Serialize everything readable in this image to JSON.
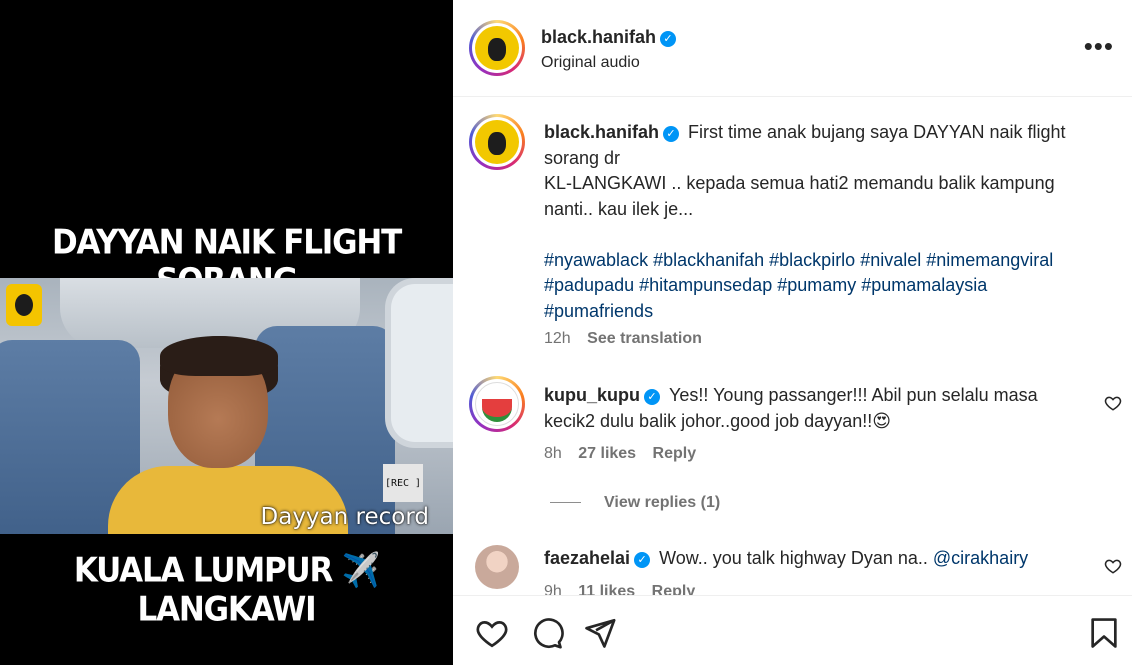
{
  "media": {
    "caption_top": "DAYYAN NAIK FLIGHT SORANG",
    "caption_bottom": "KUALA LUMPUR ✈️ LANGKAWI",
    "rec_label": "[REC ]",
    "video_label": "Dayyan record"
  },
  "header": {
    "username": "black.hanifah",
    "subline": "Original audio",
    "more_label": "•••"
  },
  "post": {
    "username": "black.hanifah",
    "caption_line1": "First time anak bujang saya DAYYAN naik flight",
    "caption_line2": "sorang dr",
    "caption_line3": "KL-LANGKAWI .. kepada semua hati2 memandu balik kampung",
    "caption_line4": "nanti.. kau ilek je...",
    "hashtags_line1": "#nyawablack #blackhanifah #blackpirlo #nivalel #nimemangviral",
    "hashtags_line2": "#padupadu #hitampunsedap #pumamy #pumamalaysia",
    "hashtags_line3": "#pumafriends",
    "time": "12h",
    "see_translation": "See translation"
  },
  "comments": [
    {
      "username": "kupu_kupu",
      "text_line1": "Yes!! Young passanger!!! Abil pun selalu masa",
      "text_line2": "kecik2 dulu balik johor..good job dayyan!!😍",
      "time": "8h",
      "likes": "27 likes",
      "reply": "Reply",
      "view_replies": "View replies (1)"
    },
    {
      "username": "faezahelai",
      "text": "Wow.. you talk highway Dyan na..",
      "mention": "@cirakhairy",
      "time": "9h",
      "likes": "11 likes",
      "reply": "Reply"
    }
  ],
  "icons": {
    "like": "heart-icon",
    "comment": "comment-icon",
    "share": "paper-plane-icon",
    "save": "bookmark-icon",
    "verified": "verified-badge-icon",
    "more": "more-options-icon"
  },
  "colors": {
    "link": "#00376b",
    "verified": "#0095f6",
    "muted": "#737373"
  }
}
